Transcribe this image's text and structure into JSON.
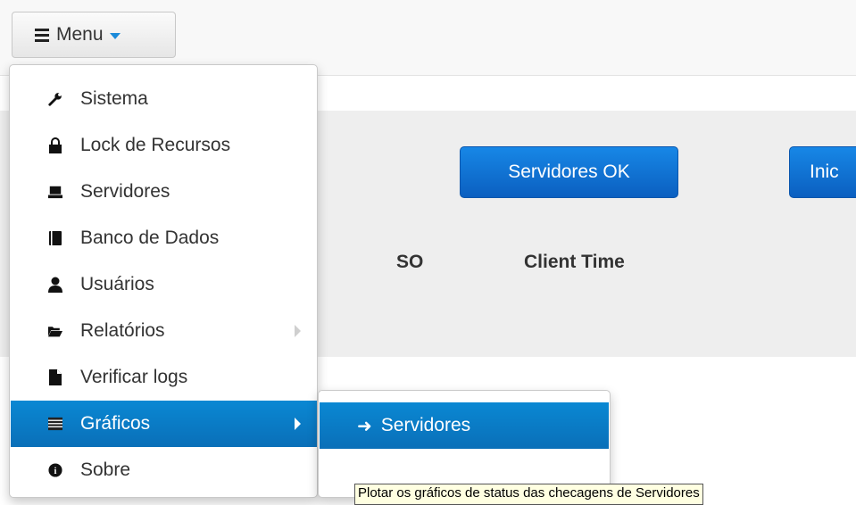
{
  "header": {
    "menu_label": "Menu"
  },
  "panel": {
    "buttons": [
      "Servidores OK",
      "Inic"
    ],
    "columns": [
      "SO",
      "Client Time"
    ]
  },
  "dropdown": {
    "items": [
      {
        "label": "Sistema",
        "icon": "wrench-icon"
      },
      {
        "label": "Lock de Recursos",
        "icon": "lock-icon"
      },
      {
        "label": "Servidores",
        "icon": "server-icon"
      },
      {
        "label": "Banco de Dados",
        "icon": "book-icon"
      },
      {
        "label": "Usuários",
        "icon": "user-icon"
      },
      {
        "label": "Relatórios",
        "icon": "folder-open-icon"
      },
      {
        "label": "Verificar logs",
        "icon": "file-icon"
      },
      {
        "label": "Gráficos",
        "icon": "list-lines-icon"
      },
      {
        "label": "Sobre",
        "icon": "info-circle-icon"
      }
    ],
    "active_index": 7
  },
  "submenu": {
    "items": [
      {
        "label": "Servidores",
        "icon": "arrow-right-icon"
      }
    ]
  },
  "tooltip": {
    "text": "Plotar os gráficos de status das checagens de Servidores"
  },
  "colors": {
    "accent": "#0a7ec7",
    "button_blue": "#0d6fd1"
  }
}
